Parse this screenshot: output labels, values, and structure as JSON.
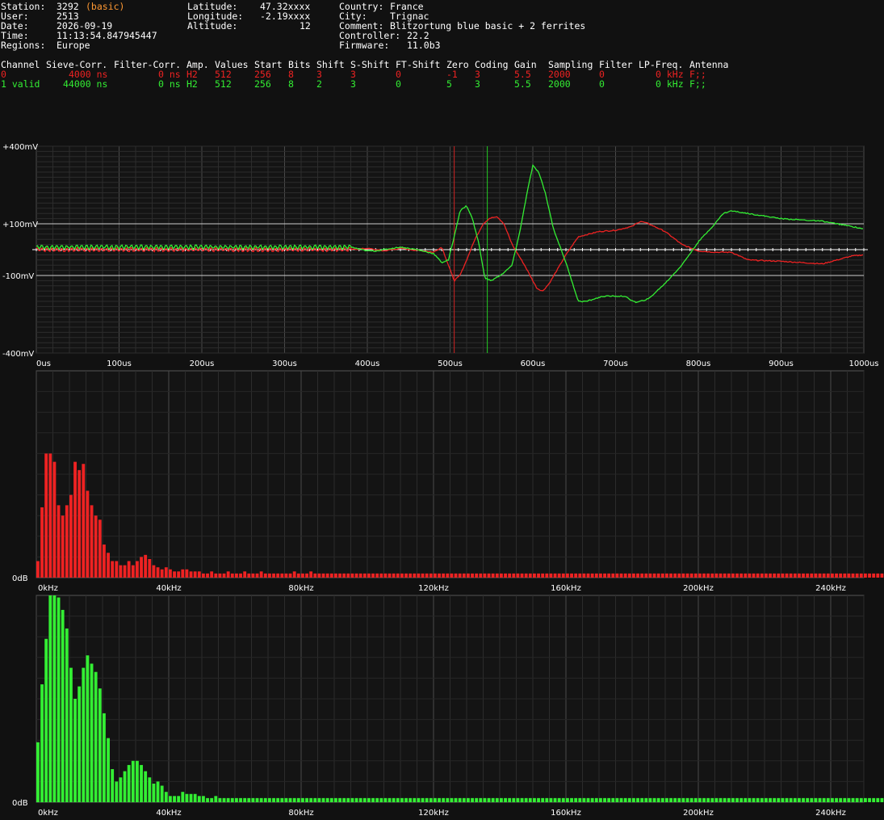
{
  "header": {
    "station_label": "Station:",
    "station_value": "3292",
    "station_badge": "(basic)",
    "user_label": "User:",
    "user_value": "2513",
    "date_label": "Date:",
    "date_value": "2026-09-19",
    "time_label": "Time:",
    "time_value": "11:13:54.847945447",
    "regions_label": "Regions:",
    "regions_value": "Europe",
    "latitude_label": "Latitude:",
    "latitude_value": "47.32xxxx",
    "longitude_label": "Longitude:",
    "longitude_value": "-2.19xxxx",
    "altitude_label": "Altitude:",
    "altitude_value": "12",
    "country_label": "Country:",
    "country_value": "France",
    "city_label": "City:",
    "city_value": "Trignac",
    "comment_label": "Comment:",
    "comment_value": "Blitzortung blue basic + 2 ferrites",
    "controller_label": "Controller:",
    "controller_value": "22.2",
    "firmware_label": "Firmware:",
    "firmware_value": "11.0b3"
  },
  "channel_table": {
    "headers": [
      "Channel",
      "Sieve-Corr.",
      "Filter-Corr.",
      "Amp.",
      "Values",
      "Start",
      "Bits",
      "Shift",
      "S-Shift",
      "FT-Shift",
      "Zero",
      "Coding",
      "Gain",
      "Sampling",
      "Filter",
      "LP-Freq.",
      "Antenna"
    ],
    "rows": [
      {
        "channel": "0",
        "sieve": "4000 ns",
        "filter_corr": "0 ns",
        "amp": "H2",
        "values": "512",
        "start": "256",
        "bits": "8",
        "shift": "3",
        "s_shift": "3",
        "ft_shift": "0",
        "zero": "-1",
        "coding": "3",
        "gain": "5.5",
        "sampling": "2000",
        "filter": "0",
        "lp_freq": "0 kHz",
        "antenna": "F;;",
        "color": "#ee2222"
      },
      {
        "channel": "1 valid",
        "sieve": "44000 ns",
        "filter_corr": "0 ns",
        "amp": "H2",
        "values": "512",
        "start": "256",
        "bits": "8",
        "shift": "2",
        "s_shift": "3",
        "ft_shift": "0",
        "zero": "5",
        "coding": "3",
        "gain": "5.5",
        "sampling": "2000",
        "filter": "0",
        "lp_freq": "0 kHz",
        "antenna": "F;;",
        "color": "#33ee33"
      }
    ]
  },
  "chart_data": [
    {
      "type": "line",
      "title": "",
      "xlabel": "",
      "ylabel": "",
      "xlim": [
        0,
        1000
      ],
      "ylim": [
        -400,
        400
      ],
      "x_ticks": [
        "0us",
        "100us",
        "200us",
        "300us",
        "400us",
        "500us",
        "600us",
        "700us",
        "800us",
        "900us",
        "1000us"
      ],
      "y_ticks": [
        "+400mV",
        "+100mV",
        "-100mV",
        "-400mV"
      ],
      "y_tick_values": [
        400,
        100,
        -100,
        -400
      ],
      "grid": true,
      "marker_lines_us": [
        {
          "x": 505,
          "color": "#cc2222"
        },
        {
          "x": 545,
          "color": "#22cc22"
        }
      ],
      "series": [
        {
          "color": "#ee2222",
          "noise": 6,
          "points": [
            [
              0,
              0
            ],
            [
              380,
              0
            ],
            [
              400,
              5
            ],
            [
              420,
              -5
            ],
            [
              440,
              5
            ],
            [
              460,
              -3
            ],
            [
              470,
              -5
            ],
            [
              480,
              -10
            ],
            [
              490,
              10
            ],
            [
              498,
              -60
            ],
            [
              505,
              -120
            ],
            [
              512,
              -100
            ],
            [
              520,
              -40
            ],
            [
              530,
              40
            ],
            [
              540,
              100
            ],
            [
              550,
              125
            ],
            [
              557,
              128
            ],
            [
              565,
              100
            ],
            [
              575,
              20
            ],
            [
              590,
              -60
            ],
            [
              605,
              -150
            ],
            [
              612,
              -160
            ],
            [
              620,
              -130
            ],
            [
              640,
              -20
            ],
            [
              655,
              50
            ],
            [
              680,
              70
            ],
            [
              700,
              75
            ],
            [
              720,
              90
            ],
            [
              730,
              110
            ],
            [
              740,
              100
            ],
            [
              760,
              70
            ],
            [
              780,
              20
            ],
            [
              800,
              -5
            ],
            [
              820,
              -10
            ],
            [
              840,
              -10
            ],
            [
              860,
              -40
            ],
            [
              900,
              -45
            ],
            [
              950,
              -55
            ],
            [
              985,
              -25
            ],
            [
              1000,
              -20
            ]
          ]
        },
        {
          "color": "#33ee33",
          "noise": 6,
          "points": [
            [
              0,
              10
            ],
            [
              380,
              10
            ],
            [
              400,
              -5
            ],
            [
              410,
              -5
            ],
            [
              420,
              0
            ],
            [
              440,
              10
            ],
            [
              460,
              0
            ],
            [
              480,
              -15
            ],
            [
              490,
              -50
            ],
            [
              498,
              -40
            ],
            [
              505,
              50
            ],
            [
              512,
              150
            ],
            [
              520,
              170
            ],
            [
              527,
              120
            ],
            [
              535,
              20
            ],
            [
              542,
              -110
            ],
            [
              550,
              -120
            ],
            [
              565,
              -90
            ],
            [
              575,
              -60
            ],
            [
              585,
              80
            ],
            [
              593,
              220
            ],
            [
              600,
              325
            ],
            [
              607,
              300
            ],
            [
              615,
              220
            ],
            [
              625,
              80
            ],
            [
              640,
              -50
            ],
            [
              655,
              -200
            ],
            [
              665,
              -200
            ],
            [
              685,
              -180
            ],
            [
              710,
              -180
            ],
            [
              725,
              -205
            ],
            [
              740,
              -190
            ],
            [
              760,
              -130
            ],
            [
              780,
              -60
            ],
            [
              800,
              30
            ],
            [
              820,
              100
            ],
            [
              830,
              140
            ],
            [
              840,
              150
            ],
            [
              860,
              140
            ],
            [
              900,
              120
            ],
            [
              950,
              110
            ],
            [
              985,
              90
            ],
            [
              1000,
              80
            ]
          ]
        }
      ]
    },
    {
      "type": "bar",
      "title": "",
      "xlim": [
        0,
        250
      ],
      "ylim": [
        0,
        100
      ],
      "x_ticks": [
        "0kHz",
        "40kHz",
        "80kHz",
        "120kHz",
        "160kHz",
        "200kHz",
        "240kHz"
      ],
      "x_tick_values": [
        0,
        40,
        80,
        120,
        160,
        200,
        240
      ],
      "y_ticks": [
        "0dB"
      ],
      "color": "#ee2222",
      "bin_width_khz": 1.25,
      "values": [
        8,
        34,
        60,
        60,
        56,
        35,
        30,
        35,
        40,
        56,
        52,
        55,
        42,
        35,
        30,
        28,
        16,
        12,
        8,
        8,
        6,
        6,
        8,
        6,
        8,
        10,
        11,
        9,
        6,
        5,
        4,
        5,
        4,
        3,
        3,
        4,
        4,
        3,
        3,
        3,
        2,
        2,
        3,
        2,
        2,
        2,
        3,
        2,
        2,
        2,
        3,
        2,
        2,
        2,
        3,
        2,
        2,
        2,
        2,
        2,
        2,
        2,
        3,
        2,
        2,
        2,
        3,
        2,
        2,
        2,
        2,
        2,
        2,
        2,
        2,
        2,
        2,
        2,
        2,
        2,
        2,
        2,
        2,
        2,
        2,
        2,
        2,
        2,
        2,
        2,
        2,
        2,
        2,
        2,
        2,
        2,
        2,
        2,
        2,
        2,
        2,
        2,
        2,
        2,
        2,
        2,
        2,
        2,
        2,
        2,
        2,
        2,
        2,
        2,
        2,
        2,
        2,
        2,
        2,
        2,
        2,
        2,
        2,
        2,
        2,
        2,
        2,
        2,
        2,
        2,
        2,
        2,
        2,
        2,
        2,
        2,
        2,
        2,
        2,
        2,
        2,
        2,
        2,
        2,
        2,
        2,
        2,
        2,
        2,
        2,
        2,
        2,
        2,
        2,
        2,
        2,
        2,
        2,
        2,
        2,
        2,
        2,
        2,
        2,
        2,
        2,
        2,
        2,
        2,
        2,
        2,
        2,
        2,
        2,
        2,
        2,
        2,
        2,
        2,
        2,
        2,
        2,
        2,
        2,
        2,
        2,
        2,
        2,
        2,
        2,
        2,
        2,
        2,
        2,
        2,
        2,
        2,
        2,
        2,
        2,
        2,
        2,
        2,
        2,
        2,
        2,
        2,
        2,
        2,
        2,
        2,
        2,
        2,
        2,
        2,
        2,
        2,
        2,
        2,
        2,
        2,
        2,
        2,
        2,
        2,
        2,
        2,
        2,
        2,
        2,
        2,
        2,
        2,
        2,
        2,
        2,
        2,
        2,
        2,
        2,
        2,
        2,
        2,
        2,
        2,
        2,
        3,
        3,
        3,
        4,
        4,
        5
      ]
    },
    {
      "type": "bar",
      "title": "",
      "xlim": [
        0,
        250
      ],
      "ylim": [
        0,
        100
      ],
      "x_ticks": [
        "0kHz",
        "40kHz",
        "80kHz",
        "120kHz",
        "160kHz",
        "200kHz",
        "240kHz"
      ],
      "x_tick_values": [
        0,
        40,
        80,
        120,
        160,
        200,
        240
      ],
      "y_ticks": [
        "0dB"
      ],
      "color": "#33ee33",
      "bin_width_khz": 1.25,
      "values": [
        29,
        57,
        79,
        100,
        100,
        99,
        93,
        84,
        65,
        50,
        56,
        65,
        71,
        67,
        63,
        55,
        43,
        31,
        16,
        10,
        12,
        15,
        18,
        20,
        20,
        18,
        15,
        12,
        9,
        10,
        8,
        5,
        3,
        3,
        3,
        5,
        4,
        4,
        4,
        3,
        3,
        2,
        2,
        3,
        2,
        2,
        2,
        2,
        2,
        2,
        2,
        2,
        2,
        2,
        2,
        2,
        2,
        2,
        2,
        2,
        2,
        2,
        2,
        2,
        2,
        2,
        2,
        2,
        2,
        2,
        2,
        2,
        2,
        2,
        2,
        2,
        2,
        2,
        2,
        2,
        2,
        2,
        2,
        2,
        2,
        2,
        2,
        2,
        2,
        2,
        2,
        2,
        2,
        2,
        2,
        2,
        2,
        2,
        2,
        2,
        2,
        2,
        2,
        2,
        2,
        2,
        2,
        2,
        2,
        2,
        2,
        2,
        2,
        2,
        2,
        2,
        2,
        2,
        2,
        2,
        2,
        2,
        2,
        2,
        2,
        2,
        2,
        2,
        2,
        2,
        2,
        2,
        2,
        2,
        2,
        2,
        2,
        2,
        2,
        2,
        2,
        2,
        2,
        2,
        2,
        2,
        2,
        2,
        2,
        2,
        2,
        2,
        2,
        2,
        2,
        2,
        2,
        2,
        2,
        2,
        2,
        2,
        2,
        2,
        2,
        2,
        2,
        2,
        2,
        2,
        2,
        2,
        2,
        2,
        2,
        2,
        2,
        2,
        2,
        2,
        2,
        2,
        2,
        2,
        2,
        2,
        2,
        2,
        2,
        2,
        2,
        2,
        2,
        2,
        2,
        2,
        2,
        2,
        2,
        2,
        2,
        2,
        2,
        2,
        2,
        2,
        2,
        2,
        2,
        2,
        2,
        2,
        2,
        2,
        2,
        2,
        2,
        2,
        2,
        2,
        2,
        2,
        2,
        2,
        2,
        2,
        2,
        2,
        2,
        2,
        2,
        2,
        2,
        2,
        2,
        2,
        2,
        2,
        2,
        2,
        2,
        2,
        3,
        3,
        3,
        4,
        4,
        12
      ]
    }
  ]
}
